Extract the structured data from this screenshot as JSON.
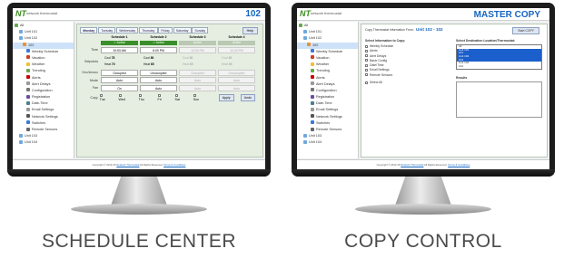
{
  "sidebar": {
    "items": [
      {
        "label": "All",
        "depth": 0,
        "icon": "house-icon",
        "color": "#6aa84f"
      },
      {
        "label": "Unit 101",
        "depth": 1,
        "icon": "thermostat-icon",
        "color": "#6fa8dc"
      },
      {
        "label": "Unit 102",
        "depth": 1,
        "icon": "thermostat-icon",
        "color": "#6fa8dc"
      },
      {
        "label": "102",
        "depth": 2,
        "icon": "unit-icon",
        "color": "#e69138",
        "selected": true
      },
      {
        "label": "Weekly Schedule",
        "depth": 3,
        "icon": "calendar-icon",
        "color": "#3c78d8"
      },
      {
        "label": "Vacation",
        "depth": 3,
        "icon": "suitcase-icon",
        "color": "#cc4125"
      },
      {
        "label": "Weather",
        "depth": 3,
        "icon": "sun-icon",
        "color": "#f1c232"
      },
      {
        "label": "Trending",
        "depth": 3,
        "icon": "chart-icon",
        "color": "#6aa84f"
      },
      {
        "label": "Alerts",
        "depth": 3,
        "icon": "alert-icon",
        "color": "#cc0000"
      },
      {
        "label": "Alert Delays",
        "depth": 3,
        "icon": "clock-icon",
        "color": "#999999"
      },
      {
        "label": "Configuration",
        "depth": 3,
        "icon": "gear-icon",
        "color": "#777777"
      },
      {
        "label": "Registration",
        "depth": 3,
        "icon": "book-icon",
        "color": "#674ea7"
      },
      {
        "label": "Date-Time",
        "depth": 3,
        "icon": "calendar-icon",
        "color": "#45818e"
      },
      {
        "label": "Email Settings",
        "depth": 3,
        "icon": "mail-icon",
        "color": "#999999"
      },
      {
        "label": "Network Settings",
        "depth": 3,
        "icon": "network-icon",
        "color": "#555555"
      },
      {
        "label": "Switches",
        "depth": 3,
        "icon": "switch-icon",
        "color": "#3c78d8"
      },
      {
        "label": "Remote Sensors",
        "depth": 3,
        "icon": "sensor-icon",
        "color": "#666666"
      },
      {
        "label": "Unit 103",
        "depth": 1,
        "icon": "thermostat-icon",
        "color": "#6fa8dc"
      },
      {
        "label": "Unit 104",
        "depth": 1,
        "icon": "thermostat-icon",
        "color": "#6fa8dc"
      }
    ]
  },
  "brand": {
    "letters": "NT",
    "name": "network thermostat"
  },
  "schedule_screen": {
    "unit_title": "102",
    "tabs": [
      "Monday",
      "Tuesday",
      "Wednesday",
      "Thursday",
      "Friday",
      "Saturday",
      "Sunday"
    ],
    "help": "Help",
    "schedules": [
      "Schedule 1",
      "Schedule 2",
      "Schedule 3",
      "Schedule 4"
    ],
    "active": "✓ Active",
    "inactive": "Active",
    "time_label": "Time",
    "times": [
      "10:53 AM",
      "6:00 PM",
      "12:00 PM",
      "10:00 PM"
    ],
    "setpoint_label": "Setpoints",
    "cool_label": "Cool",
    "heat_label": "Heat",
    "cool_vals": [
      "78",
      "80",
      "80",
      "80"
    ],
    "heat_vals": [
      "70",
      "65",
      "65",
      "65"
    ],
    "occ_label": "Occ/Unocc",
    "occ_vals": [
      "Occupied",
      "Unoccupied",
      "Occupied",
      "Unoccupied"
    ],
    "mode_label": "Mode",
    "mode_vals": [
      "Auto",
      "Auto",
      "Auto",
      "Auto"
    ],
    "fan_label": "Fan",
    "fan_vals": [
      "On",
      "Auto",
      "Auto",
      "Auto"
    ],
    "copy_label": "Copy",
    "copy_days": [
      "Tue",
      "Wed",
      "Thu",
      "Fri",
      "Sat",
      "Sun"
    ],
    "apply": "Apply",
    "undo": "Undo"
  },
  "copy_screen": {
    "title": "MASTER COPY",
    "copy_info_label": "Copy Thermostat Information From:",
    "copy_from": "Unit 102 - 102",
    "start_copy": "Start COPY",
    "select_info": "Select Information to Copy:",
    "options": [
      "Weekly Schedule",
      "Alerts",
      "Alert Delays",
      "Basic Config",
      "Date/Time",
      "Email Settings",
      "Remote Sensors"
    ],
    "select_all": "Select All",
    "dest_label": "Select Destination Location/Thermostat:",
    "dest_items": [
      {
        "label": "All",
        "hl": false
      },
      {
        "label": "Unit 101",
        "hl": true
      },
      {
        "label": "  101",
        "hl": true
      },
      {
        "label": "Unit 103",
        "hl": true
      },
      {
        "label": "  103",
        "hl": true
      },
      {
        "label": "Unit 104",
        "hl": false
      },
      {
        "label": "  104",
        "hl": false
      }
    ],
    "results": "Results"
  },
  "footer": {
    "prefix": "Copyright © 2013-15 ",
    "link": "Network Thermostat",
    "suffix": " All Rights Reserved.  ",
    "terms": "Terms & Conditions"
  },
  "captions": {
    "left": "SCHEDULE CENTER",
    "right": "COPY CONTROL"
  }
}
